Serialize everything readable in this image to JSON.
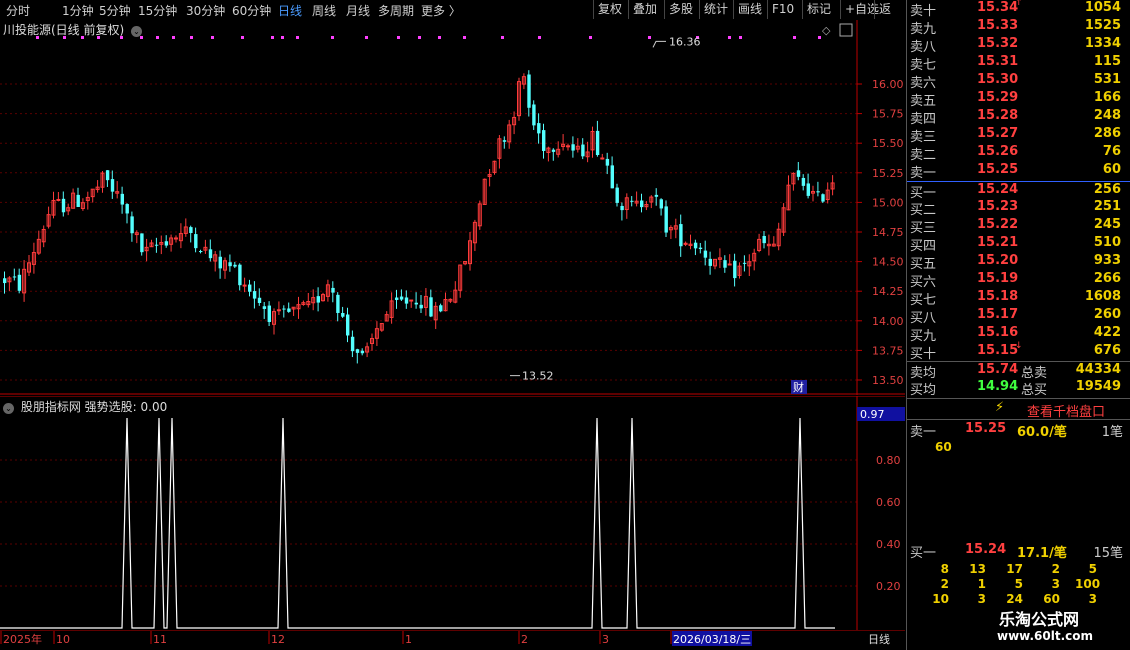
{
  "toolbar": {
    "left_items": [
      {
        "label": "分时",
        "active": false
      },
      {
        "label": "1分钟",
        "active": false
      },
      {
        "label": "5分钟",
        "active": false
      },
      {
        "label": "15分钟",
        "active": false
      },
      {
        "label": "30分钟",
        "active": false
      },
      {
        "label": "60分钟",
        "active": false
      },
      {
        "label": "日线",
        "active": true
      },
      {
        "label": "周线",
        "active": false
      },
      {
        "label": "月线",
        "active": false
      },
      {
        "label": "多周期",
        "active": false
      },
      {
        "label": "更多 〉",
        "active": false
      }
    ],
    "right_items": [
      "复权",
      "叠加",
      "多股",
      "统计",
      "画线",
      "F10",
      "标记",
      "+自选",
      "返回"
    ]
  },
  "main_chart": {
    "title": "川投能源(日线 前复权)",
    "high_label": "16.36",
    "low_label": "13.52",
    "cai_marker": "财",
    "y_ticks": [
      "16.00",
      "15.75",
      "15.50",
      "15.25",
      "15.00",
      "14.75",
      "14.50",
      "14.25",
      "14.00",
      "13.75",
      "13.50"
    ]
  },
  "indicator": {
    "title": "股朋指标网 强势选股: 0.00",
    "current_value": "0.97",
    "y_ticks": [
      "0.80",
      "0.60",
      "0.40",
      "0.20"
    ]
  },
  "time_axis": {
    "labels": [
      "2025年",
      "10",
      "11",
      "12",
      "1",
      "2",
      "3",
      "2026/03/18/三"
    ],
    "period_label": "日线"
  },
  "order_book": {
    "sell": [
      {
        "label": "卖十",
        "price": "15.34",
        "vol": "1054",
        "mark": "↑"
      },
      {
        "label": "卖九",
        "price": "15.33",
        "vol": "1525",
        "mark": ""
      },
      {
        "label": "卖八",
        "price": "15.32",
        "vol": "1334",
        "mark": ""
      },
      {
        "label": "卖七",
        "price": "15.31",
        "vol": "115",
        "mark": ""
      },
      {
        "label": "卖六",
        "price": "15.30",
        "vol": "531",
        "mark": ""
      },
      {
        "label": "卖五",
        "price": "15.29",
        "vol": "166",
        "mark": ""
      },
      {
        "label": "卖四",
        "price": "15.28",
        "vol": "248",
        "mark": ""
      },
      {
        "label": "卖三",
        "price": "15.27",
        "vol": "286",
        "mark": ""
      },
      {
        "label": "卖二",
        "price": "15.26",
        "vol": "76",
        "mark": ""
      },
      {
        "label": "卖一",
        "price": "15.25",
        "vol": "60",
        "mark": ""
      }
    ],
    "buy": [
      {
        "label": "买一",
        "price": "15.24",
        "vol": "256",
        "mark": ""
      },
      {
        "label": "买二",
        "price": "15.23",
        "vol": "251",
        "mark": ""
      },
      {
        "label": "买三",
        "price": "15.22",
        "vol": "245",
        "mark": ""
      },
      {
        "label": "买四",
        "price": "15.21",
        "vol": "510",
        "mark": ""
      },
      {
        "label": "买五",
        "price": "15.20",
        "vol": "933",
        "mark": ""
      },
      {
        "label": "买六",
        "price": "15.19",
        "vol": "266",
        "mark": ""
      },
      {
        "label": "买七",
        "price": "15.18",
        "vol": "1608",
        "mark": ""
      },
      {
        "label": "买八",
        "price": "15.17",
        "vol": "260",
        "mark": ""
      },
      {
        "label": "买九",
        "price": "15.16",
        "vol": "422",
        "mark": ""
      },
      {
        "label": "买十",
        "price": "15.15",
        "vol": "676",
        "mark": "↓"
      }
    ],
    "sell_avg_label": "卖均",
    "sell_avg": "15.74",
    "total_sell_label": "总卖",
    "total_sell": "44334",
    "buy_avg_label": "买均",
    "buy_avg": "14.94",
    "total_buy_label": "总买",
    "total_buy": "19549",
    "thousand_btn": "查看千档盘口",
    "detail_sell": {
      "label": "卖一",
      "price": "15.25",
      "per": "60.0/笔",
      "count": "1笔",
      "queue": [
        "60"
      ]
    },
    "detail_buy": {
      "label": "买一",
      "price": "15.24",
      "per": "17.1/笔",
      "count": "15笔",
      "queue": [
        [
          "8",
          "13",
          "17",
          "2",
          "5"
        ],
        [
          "2",
          "1",
          "5",
          "3",
          "100"
        ],
        [
          "10",
          "3",
          "24",
          "60",
          "3"
        ]
      ]
    },
    "watermark_cn": "乐淘公式网",
    "watermark_url": "www.60lt.com"
  },
  "colors": {
    "up": "#ff3b3b",
    "down": "#54ffff",
    "purple": "#ff40ff",
    "ask": "#ff4040",
    "bid": "#40ff40"
  },
  "chart_data": {
    "type": "candlestick",
    "ylim": [
      13.4,
      16.35
    ],
    "price_extremes": {
      "high": 16.36,
      "low": 13.52
    },
    "indicator_signal_days": [
      31,
      39,
      42,
      70,
      147,
      156,
      198
    ],
    "indicator_ylim": [
      0,
      1.0
    ]
  }
}
